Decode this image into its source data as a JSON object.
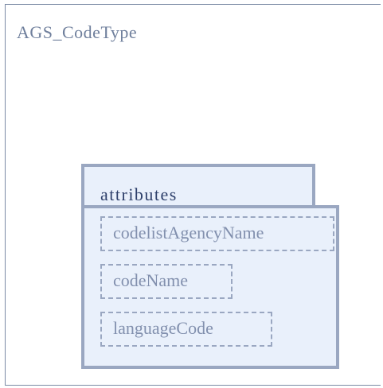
{
  "type": {
    "name": "AGS_CodeType"
  },
  "group": {
    "label": "attributes",
    "items": [
      {
        "name": "codelistAgencyName"
      },
      {
        "name": "codeName"
      },
      {
        "name": "languageCode"
      }
    ]
  },
  "colors": {
    "border": "#7b8aa5",
    "group_fill": "#e9f0fb",
    "group_border": "#9aa7c1",
    "title_text": "#6f7f9c",
    "group_label_text": "#2d3f6a",
    "attr_text": "#8290ae"
  }
}
